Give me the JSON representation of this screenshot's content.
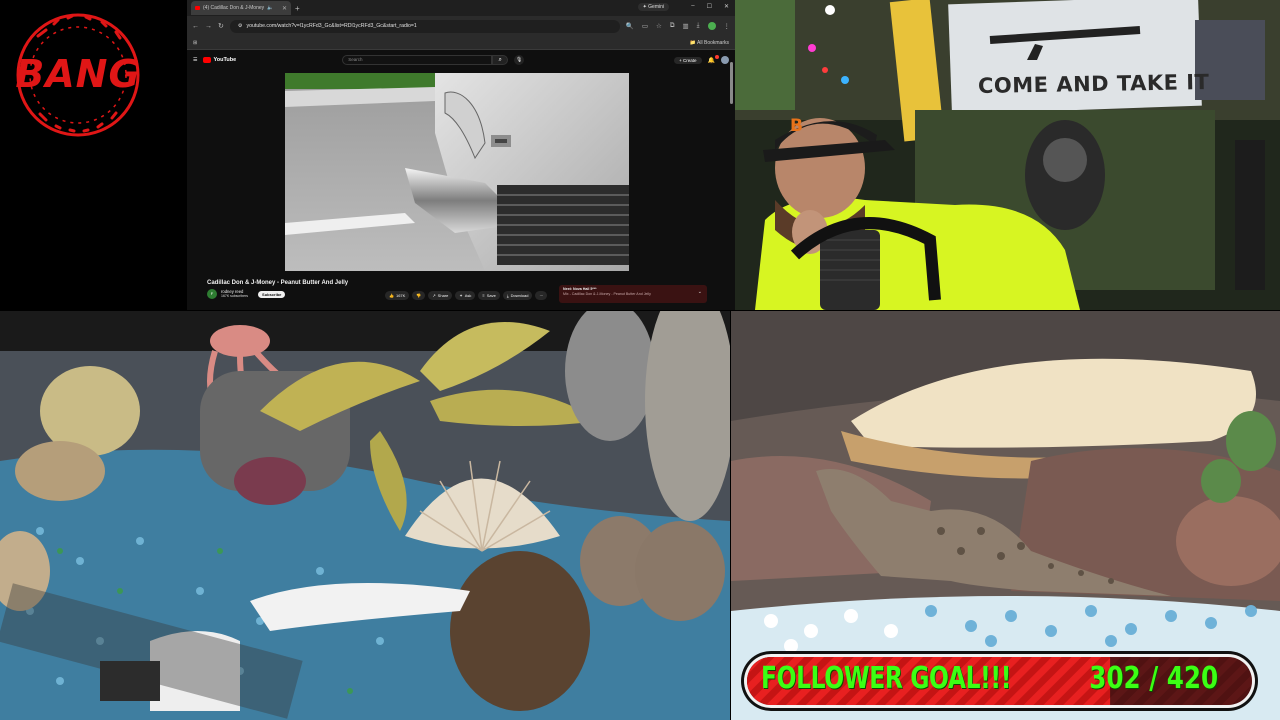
{
  "logo": {
    "word": "BANG",
    "ring_text": "ｼﾙｸﾖﾗｲｶﾅ ｿｨﾚﾝﾚﾝ",
    "color": "#e01616"
  },
  "browser": {
    "tab_title": "(4) Cadillac Don & J-Money",
    "new_tab": "+",
    "gemini_label": "Gemini",
    "window_controls": [
      "–",
      "☐",
      "✕"
    ],
    "url": "youtube.com/watch?v=l1ycRFd3_Gc&list=RDl1ycRFd3_Gc&start_radio=1",
    "bookmarks_label": "All Bookmarks"
  },
  "youtube": {
    "logo_text": "YouTube",
    "search_placeholder": "Search",
    "create_label": "Create",
    "video_title": "Cadillac Don & J-Money - Peanut Butter And Jelly",
    "channel_initial": "F",
    "channel_name": "rodney reed",
    "subscribers": "167K subscribers",
    "subscribe_label": "Subscribe",
    "actions": {
      "like_count": "167K",
      "share": "Share",
      "ask": "Ask",
      "save": "Save",
      "download": "Download",
      "more": "···"
    },
    "up_next": {
      "heading": "Next: Nova Hail 5***",
      "subtitle": "Mix - Cadillac Don & J-Money - Peanut Butter And Jelly"
    },
    "accent": "#ff0000"
  },
  "webcam": {
    "flag_text": "COME AND TAKE IT",
    "cap_logo": "B"
  },
  "follower_goal": {
    "label": "FOLLOWER GOAL!!!",
    "current": "302",
    "separator": "/",
    "target": "420",
    "progress": 0.719,
    "text_color": "#3cff14",
    "banner_color": "#e01b1b"
  }
}
